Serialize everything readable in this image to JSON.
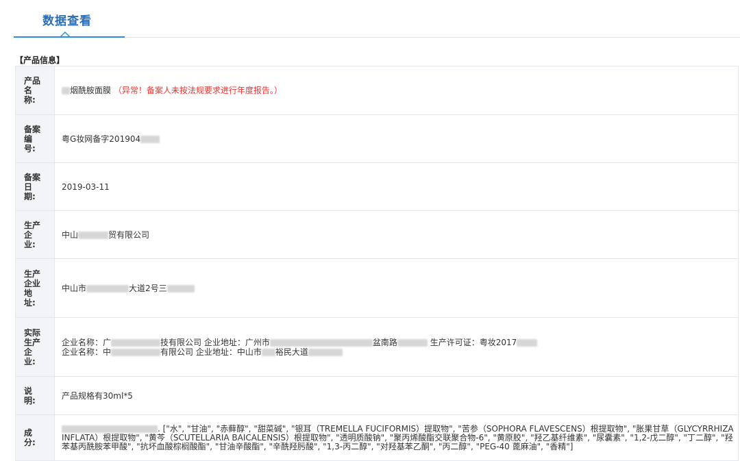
{
  "header": {
    "tab_title": "数据查看"
  },
  "section": {
    "title": "【产品信息】"
  },
  "fields": {
    "product_name": {
      "label": "产品名称:",
      "value": "烟酰胺面膜",
      "warning": "（异常！备案人未按法规要求进行年度报告。）"
    },
    "record_no": {
      "label": "备案编号:",
      "value": "粤G妆网备字201904"
    },
    "record_date": {
      "label": "备案日期:",
      "value": "2019-03-11"
    },
    "manufacturer": {
      "label": "生产企业:",
      "value_prefix": "中山",
      "value_suffix": "贸有限公司"
    },
    "manufacturer_address": {
      "label": "生产企业地址:",
      "value_prefix": "中山市",
      "value_mid": "大道2号三"
    },
    "actual_manufacturer": {
      "label": "实际生产企业:",
      "line1": {
        "name_label": "企业名称：广",
        "name_suffix": "技有限公司",
        "addr_label": "企业地址：广州市",
        "addr_suffix": "盆南路",
        "license_label": "生产许可证：粤妆2017"
      },
      "line2": {
        "name_label": "企业名称：中",
        "name_suffix": "有限公司",
        "addr_label": "企业地址：中山市",
        "addr_suffix": "裕民大道"
      }
    },
    "description": {
      "label": "说明:",
      "value": "产品规格有30ml*5"
    },
    "ingredients": {
      "label": "成分:",
      "value": ". [\"水\", \"甘油\", \"赤藓醇\", \"甜菜碱\", \"银耳（TREMELLA FUCIFORMIS）提取物\", \"苦参（SOPHORA FLAVESCENS）根提取物\", \"胀果甘草（GLYCYRRHIZA INFLATA）根提取物\", \"黄芩（SCUTELLARIA BAICALENSIS）根提取物\", \"透明质酸钠\", \"聚丙烯酸酯交联聚合物-6\", \"黄原胶\", \"羟乙基纤维素\", \"尿囊素\", \"1,2-戊二醇\", \"丁二醇\", \"羟苯基丙酰胺苯甲酸\", \"抗坏血酸棕榈酸酯\", \"甘油辛酸酯\", \"辛酰羟肟酸\", \"1,3-丙二醇\", \"对羟基苯乙酮\", \"丙二醇\", \"PEG-40 蓖麻油\", \"香精\"]"
    }
  }
}
